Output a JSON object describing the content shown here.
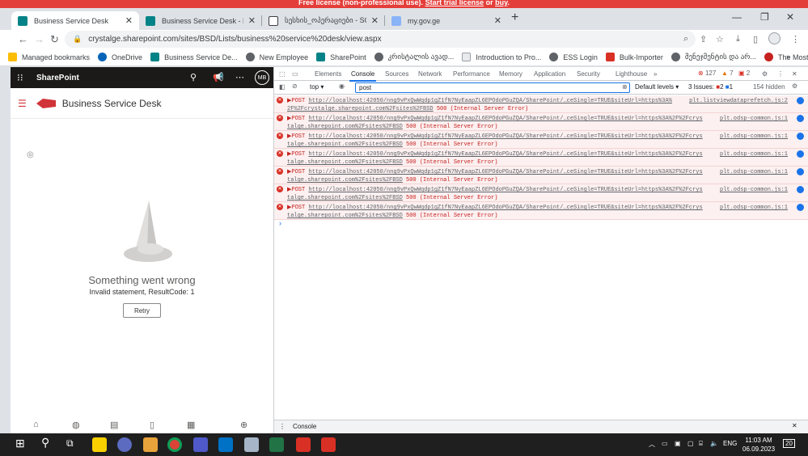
{
  "banner": {
    "prefix": "Free license (non-professional use). ",
    "trial_link": "Start trial license",
    "or": " or ",
    "buy_link": "buy",
    "suffix": "."
  },
  "tabs": [
    {
      "title": "Business Service Desk",
      "active": true
    },
    {
      "title": "Business Service Desk - Business"
    },
    {
      "title": "სესხის_ოპერაციები - SQL Ser"
    },
    {
      "title": "my.gov.ge"
    }
  ],
  "address": {
    "url": "crystalge.sharepoint.com/sites/BSD/Lists/business%20service%20desk/view.aspx"
  },
  "bookmarks": [
    "Managed bookmarks",
    "OneDrive",
    "Business Service De...",
    "New Employee",
    "SharePoint",
    "კრისტალის ავად...",
    "Introduction to Pro...",
    "ESS Login",
    "Bulk-Importer",
    "მენეჯმენტის და არ...",
    "The Most Trending..."
  ],
  "sharepoint": {
    "brand": "SharePoint",
    "user_initials": "MB",
    "site_title": "Business Service Desk",
    "error_title": "Something went wrong",
    "error_detail": "Invalid statement, ResultCode: 1",
    "retry_label": "Retry"
  },
  "devtools": {
    "tabs": [
      "Elements",
      "Console",
      "Sources",
      "Network",
      "Performance",
      "Memory",
      "Application",
      "Security",
      "Lighthouse"
    ],
    "errors_count": "127",
    "warnings_count": "7",
    "info_count": "2",
    "context": "top",
    "filter_value": "post",
    "levels": "Default levels",
    "issues": "3 Issues:",
    "issues_err": "2",
    "issues_info": "1",
    "hidden": "154 hidden",
    "drawer_tab": "Console",
    "rows": [
      {
        "l1": "POST ",
        "url1": "http://localhost:42050/nng9vPxQwWqdp1gZ1fN7NyEaapZL6EPOdoPGuZQA/SharePoint/…ceSingle=TRUE&siteUrl=https%3A%",
        "url2": "2F%2Fcrystalge.sharepoint.com%2Fsites%2FBSD",
        "status": " 500 (Internal Server Error)",
        "src": "plt.listviewdataprefetch.js:2"
      },
      {
        "l1": "POST ",
        "url1": "http://localhost:42050/nng9vPxQwWqdp1gZ1fN7NyEaapZL6EPOdoPGuZQA/SharePoint/…ceSingle=TRUE&siteUrl=https%3A%2F%2Fcrys",
        "url2": "talge.sharepoint.com%2Fsites%2FBSD",
        "status": " 500 (Internal Server Error)",
        "src": "plt.odsp-common.js:1"
      },
      {
        "l1": "POST ",
        "url1": "http://localhost:42050/nng9vPxQwWqdp1gZ1fN7NyEaapZL6EPOdoPGuZQA/SharePoint/…ceSingle=TRUE&siteUrl=https%3A%2F%2Fcrys",
        "url2": "talge.sharepoint.com%2Fsites%2FBSD",
        "status": " 500 (Internal Server Error)",
        "src": "plt.odsp-common.js:1"
      },
      {
        "l1": "POST ",
        "url1": "http://localhost:42050/nng9vPxQwWqdp1gZ1fN7NyEaapZL6EPOdoPGuZQA/SharePoint/…ceSingle=TRUE&siteUrl=https%3A%2F%2Fcrys",
        "url2": "talge.sharepoint.com%2Fsites%2FBSD",
        "status": " 500 (Internal Server Error)",
        "src": "plt.odsp-common.js:1"
      },
      {
        "l1": "POST ",
        "url1": "http://localhost:42050/nng9vPxQwWqdp1gZ1fN7NyEaapZL6EPOdoPGuZQA/SharePoint/…ceSingle=TRUE&siteUrl=https%3A%2F%2Fcrys",
        "url2": "talge.sharepoint.com%2Fsites%2FBSD",
        "status": " 500 (Internal Server Error)",
        "src": "plt.odsp-common.js:1"
      },
      {
        "l1": "POST ",
        "url1": "http://localhost:42050/nng9vPxQwWqdp1gZ1fN7NyEaapZL6EPOdoPGuZQA/SharePoint/…ceSingle=TRUE&siteUrl=https%3A%2F%2Fcrys",
        "url2": "talge.sharepoint.com%2Fsites%2FBSD",
        "status": " 500 (Internal Server Error)",
        "src": "plt.odsp-common.js:1"
      },
      {
        "l1": "POST ",
        "url1": "http://localhost:42050/nng9vPxQwWqdp1gZ1fN7NyEaapZL6EPOdoPGuZQA/SharePoint/…ceSingle=TRUE&siteUrl=https%3A%2F%2Fcrys",
        "url2": "talge.sharepoint.com%2Fsites%2FBSD",
        "status": " 500 (Internal Server Error)",
        "src": "plt.odsp-common.js:1"
      }
    ]
  },
  "taskbar": {
    "lang": "ENG",
    "time": "11:03 AM",
    "date": "06.09.2023",
    "notifications": "20"
  },
  "colors": {
    "accent": "#1a73e8",
    "error": "#d93025",
    "banner": "#e43e3a",
    "sp_brand": "#d13438"
  }
}
